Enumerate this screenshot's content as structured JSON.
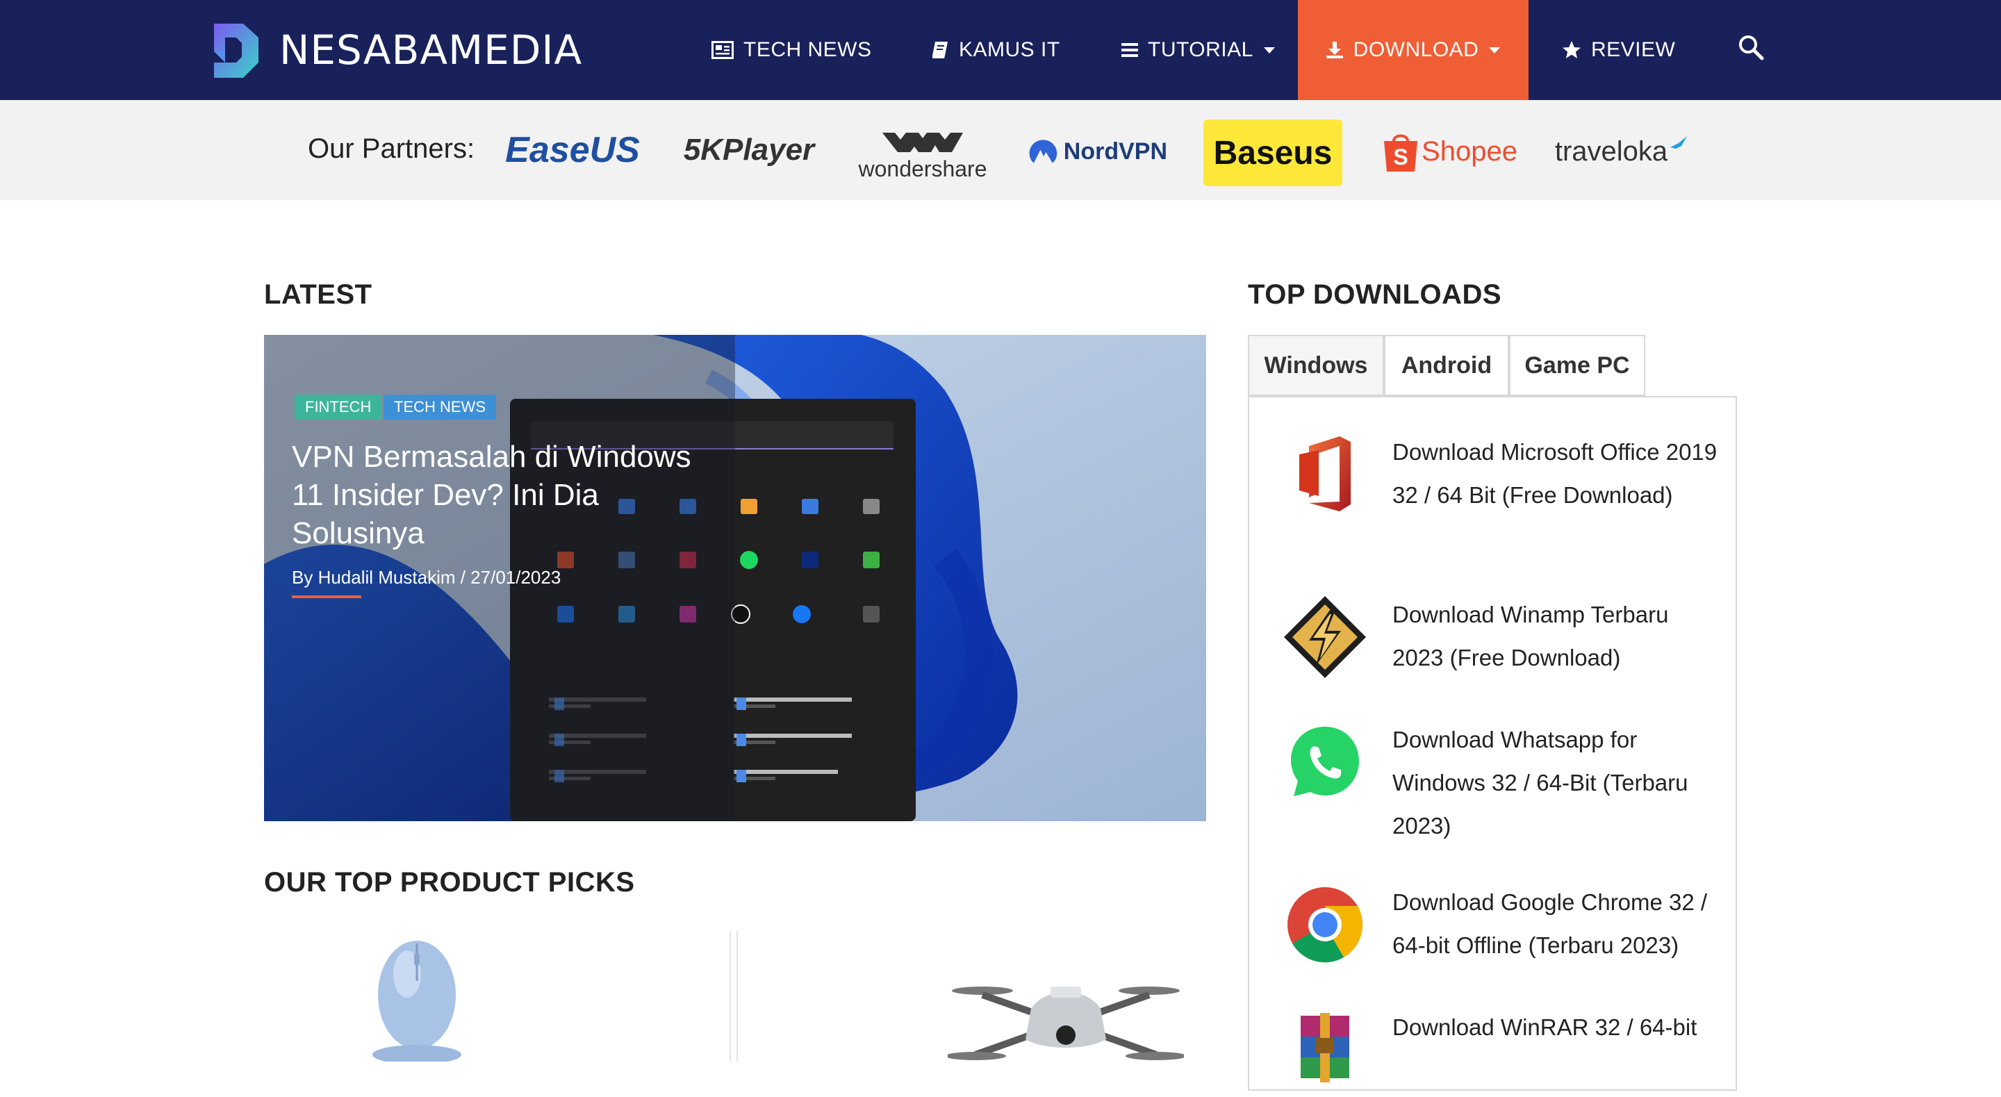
{
  "brand": {
    "name": "NESABAMEDIA",
    "accent": "#ef5e35",
    "nav_bg": "#19215a"
  },
  "nav": {
    "items": [
      {
        "label": "TECH NEWS",
        "icon": "newspaper-icon"
      },
      {
        "label": "KAMUS IT",
        "icon": "book-icon"
      },
      {
        "label": "TUTORIAL",
        "icon": "menu-bars-icon",
        "has_dropdown": true
      },
      {
        "label": "DOWNLOAD",
        "icon": "download-icon",
        "has_dropdown": true,
        "active": true
      },
      {
        "label": "REVIEW",
        "icon": "star-icon"
      }
    ],
    "search_icon": "search-icon"
  },
  "partners": {
    "label": "Our Partners:",
    "logos": [
      "EaseUS",
      "5KPlayer",
      "wondershare",
      "NordVPN",
      "Baseus",
      "Shopee",
      "traveloka"
    ]
  },
  "latest": {
    "title": "LATEST",
    "article": {
      "tags": [
        "FINTECH",
        "TECH NEWS"
      ],
      "title": "VPN Bermasalah di Windows 11 Insider Dev? Ini Dia Solusinya",
      "meta": "By Hudalil Mustakim / 27/01/2023"
    }
  },
  "picks": {
    "title": "OUR TOP PRODUCT PICKS"
  },
  "downloads": {
    "title": "TOP DOWNLOADS",
    "tabs": [
      "Windows",
      "Android",
      "Game PC"
    ],
    "items": [
      {
        "text": "Download Microsoft Office 2019 32 / 64 Bit (Free Download)",
        "icon": "office-icon"
      },
      {
        "text": "Download Winamp Terbaru 2023 (Free Download)",
        "icon": "winamp-icon"
      },
      {
        "text": "Download Whatsapp for Windows 32 / 64-Bit (Terbaru 2023)",
        "icon": "whatsapp-icon"
      },
      {
        "text": "Download Google Chrome 32 / 64-bit Offline (Terbaru 2023)",
        "icon": "chrome-icon"
      },
      {
        "text": "Download WinRAR 32 / 64-bit",
        "icon": "winrar-icon"
      }
    ]
  }
}
